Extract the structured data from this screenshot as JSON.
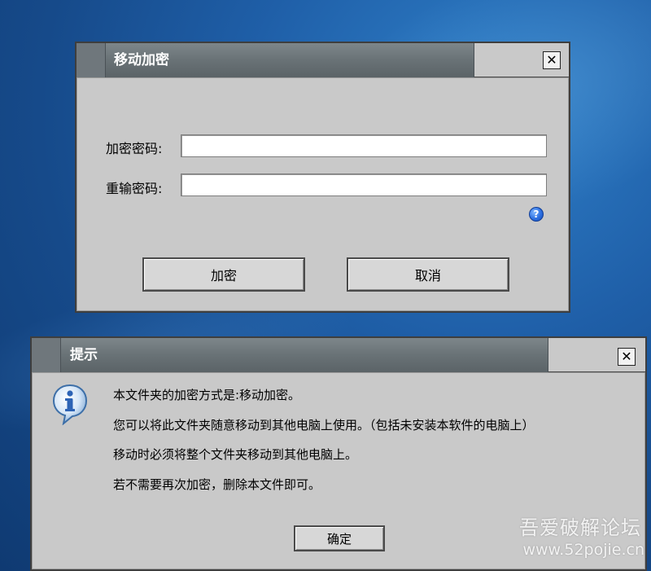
{
  "encrypt_dialog": {
    "title": "移动加密",
    "close_glyph": "✕",
    "password_label": "加密密码:",
    "password_value": "",
    "confirm_label": "重输密码:",
    "confirm_value": "",
    "help_glyph": "?",
    "encrypt_button": "加密",
    "cancel_button": "取消"
  },
  "notice_dialog": {
    "title": "提示",
    "close_glyph": "✕",
    "icon": "info-icon",
    "lines": [
      "本文件夹的加密方式是:移动加密。",
      "您可以将此文件夹随意移动到其他电脑上使用。（包括未安装本软件的电脑上）",
      "移动时必须将整个文件夹移动到其他电脑上。",
      "若不需要再次加密，删除本文件即可。"
    ],
    "ok_button": "确定"
  },
  "watermark": {
    "line1": "吾爱破解论坛",
    "line2": "www.52pojie.cn"
  }
}
